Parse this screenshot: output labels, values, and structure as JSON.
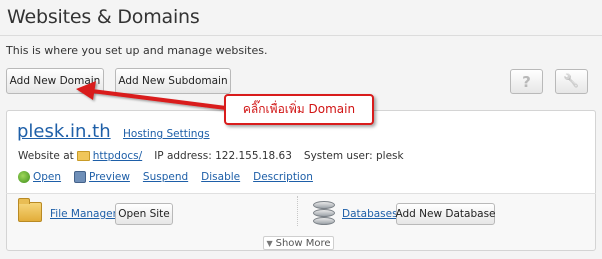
{
  "page": {
    "title": "Websites & Domains",
    "subtitle": "This is where you set up and manage websites."
  },
  "toolbar": {
    "add_domain_label": "Add New Domain",
    "add_subdomain_label": "Add New Subdomain",
    "help_label": "?",
    "tools_label": "🔧"
  },
  "annotation": {
    "text": "คลิ๊กเพื่อเพิ่ม Domain",
    "color": "#d91c1c"
  },
  "domain": {
    "name": "plesk.in.th",
    "hosting_settings": "Hosting Settings",
    "website_at_label": "Website at",
    "docroot": "httpdocs/",
    "ip_label": "IP address:",
    "ip": "122.155.18.63",
    "system_user_label": "System user:",
    "system_user": "plesk",
    "actions": [
      {
        "label": "Open",
        "icon": "open-icon"
      },
      {
        "label": "Preview",
        "icon": "preview-icon"
      },
      {
        "label": "Suspend"
      },
      {
        "label": "Disable"
      },
      {
        "label": "Description"
      }
    ]
  },
  "tools": {
    "file_manager": "File Manager",
    "open_site": "Open Site",
    "databases": "Databases",
    "add_database": "Add New Database"
  },
  "show_more": "Show More",
  "colors": {
    "link": "#1e5fa8",
    "background": "#f4f4f4"
  }
}
